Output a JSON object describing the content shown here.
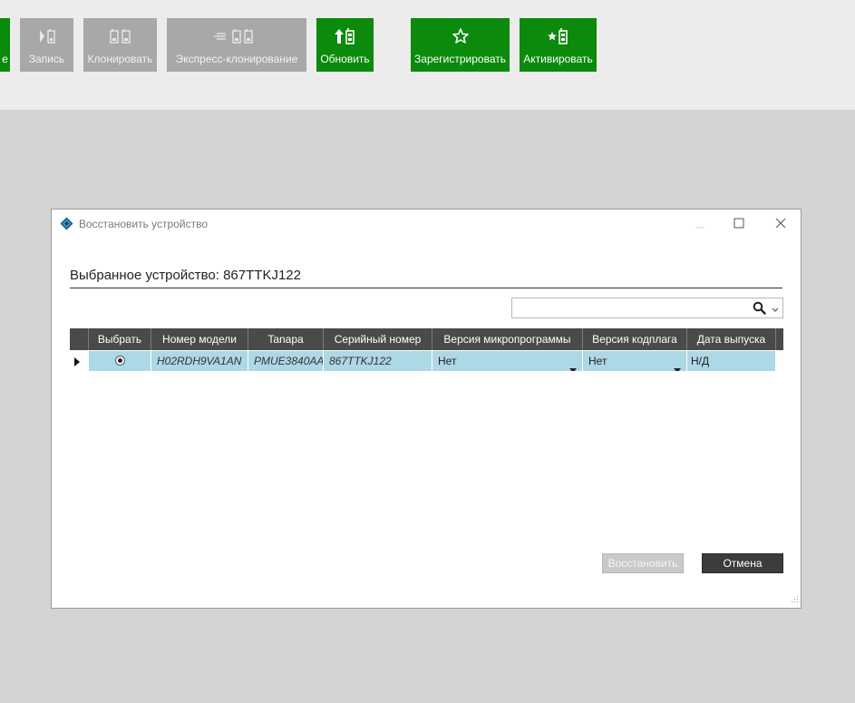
{
  "toolbar": {
    "buttons": [
      {
        "label": "е",
        "state": "enabled",
        "icon": "partial-icon"
      },
      {
        "label": "Запись",
        "state": "disabled",
        "icon": "write-radio-icon"
      },
      {
        "label": "Клонировать",
        "state": "disabled",
        "icon": "clone-radio-icon"
      },
      {
        "label": "Экспресс-клонирование",
        "state": "disabled",
        "icon": "express-clone-icon"
      },
      {
        "label": "Обновить",
        "state": "enabled",
        "icon": "update-radio-icon"
      },
      {
        "label": "Зарегистрировать",
        "state": "enabled",
        "icon": "star-icon"
      },
      {
        "label": "Активировать",
        "state": "enabled",
        "icon": "activate-radio-icon"
      }
    ],
    "colors": {
      "enabled": "#0b8a0b",
      "disabled": "#a8a8a8"
    }
  },
  "dialog": {
    "title": "Восстановить устройство",
    "heading": "Выбранное устройство: 867TTKJ122",
    "search": {
      "value": "",
      "placeholder": ""
    },
    "grid": {
      "columns": [
        "Выбрать",
        "Номер модели",
        "Tanapa",
        "Серийный номер",
        "Версия микропрограммы",
        "Версия кодплага",
        "Дата выпуска"
      ],
      "rows": [
        {
          "selected": true,
          "model": "H02RDH9VA1AN",
          "tanapa": "PMUE3840AA",
          "serial": "867TTKJ122",
          "firmware": "Нет",
          "codeplug": "Нет",
          "release_date": "Н/Д"
        }
      ]
    },
    "buttons": {
      "restore": "Восстановить",
      "cancel": "Отмена"
    },
    "colors": {
      "row_selected": "#add8e6",
      "header_bg": "#4a4a4a"
    }
  }
}
